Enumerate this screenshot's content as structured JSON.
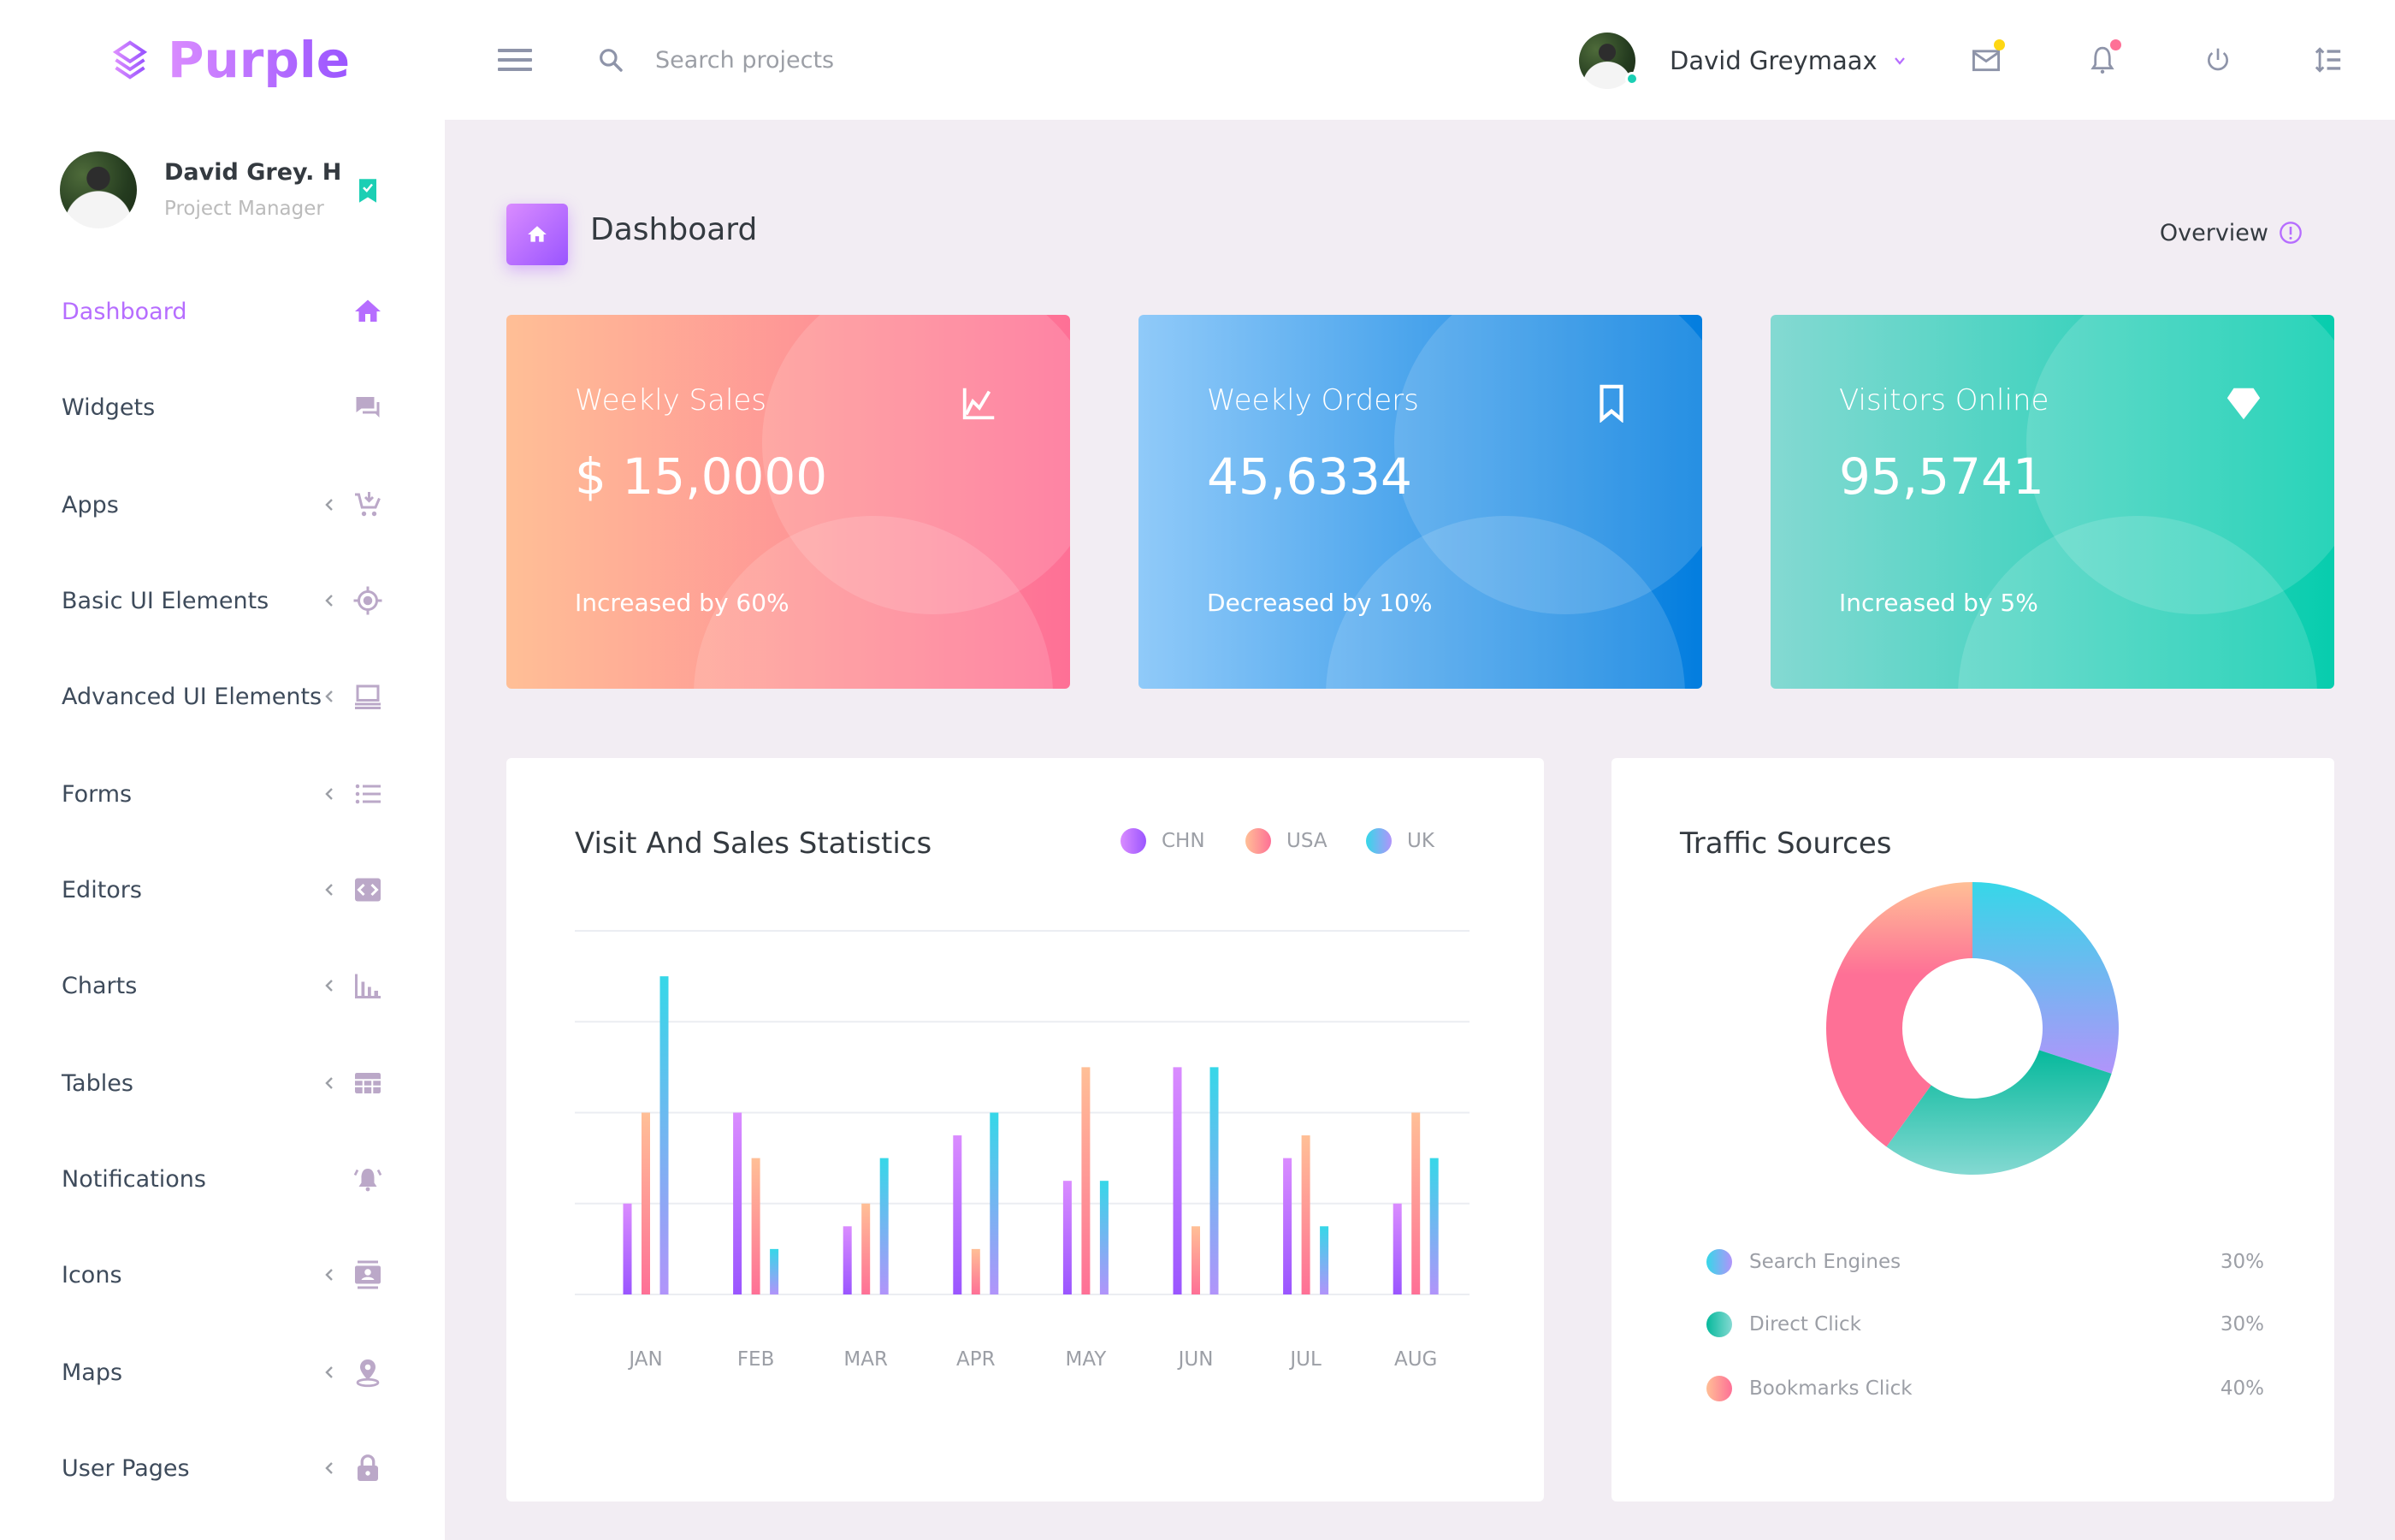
{
  "brand": {
    "name": "Purple",
    "logo_icon": "layers-icon"
  },
  "header": {
    "menu_icon": "hamburger-icon",
    "search": {
      "placeholder": "Search projects",
      "value": ""
    },
    "user": {
      "name": "David Greymaax",
      "status": "online"
    },
    "icons": [
      {
        "name": "mail-icon",
        "badge_color": "#fed713"
      },
      {
        "name": "bell-icon",
        "badge_color": "#fe7096"
      },
      {
        "name": "power-icon"
      },
      {
        "name": "format-line-spacing-icon"
      }
    ]
  },
  "sidebar": {
    "profile": {
      "name": "David Grey. H",
      "role": "Project Manager",
      "badge_icon": "bookmark-check-icon"
    },
    "items": [
      {
        "label": "Dashboard",
        "icon": "home-icon",
        "active": true,
        "expandable": false
      },
      {
        "label": "Widgets",
        "icon": "forum-icon",
        "active": false,
        "expandable": false
      },
      {
        "label": "Apps",
        "icon": "cart-arrow-down-icon",
        "active": false,
        "expandable": true
      },
      {
        "label": "Basic UI Elements",
        "icon": "crosshairs-gps-icon",
        "active": false,
        "expandable": true
      },
      {
        "label": "Advanced UI Elements",
        "icon": "laptop-icon",
        "active": false,
        "expandable": true
      },
      {
        "label": "Forms",
        "icon": "format-list-bulleted-icon",
        "active": false,
        "expandable": true
      },
      {
        "label": "Editors",
        "icon": "code-icon",
        "active": false,
        "expandable": true
      },
      {
        "label": "Charts",
        "icon": "chart-bar-icon",
        "active": false,
        "expandable": true
      },
      {
        "label": "Tables",
        "icon": "table-icon",
        "active": false,
        "expandable": true
      },
      {
        "label": "Notifications",
        "icon": "bell-ring-icon",
        "active": false,
        "expandable": false
      },
      {
        "label": "Icons",
        "icon": "contacts-icon",
        "active": false,
        "expandable": true
      },
      {
        "label": "Maps",
        "icon": "map-marker-icon",
        "active": false,
        "expandable": true
      },
      {
        "label": "User Pages",
        "icon": "lock-icon",
        "active": false,
        "expandable": true
      }
    ]
  },
  "page": {
    "title": "Dashboard",
    "overview_label": "Overview"
  },
  "cards": [
    {
      "title": "Weekly Sales",
      "value": "$ 15,0000",
      "subtitle": "Increased by 60%",
      "icon": "chart-line-icon"
    },
    {
      "title": "Weekly Orders",
      "value": "45,6334",
      "subtitle": "Decreased by 10%",
      "icon": "bookmark-outline-icon"
    },
    {
      "title": "Visitors Online",
      "value": "95,5741",
      "subtitle": "Increased by 5%",
      "icon": "diamond-icon"
    }
  ],
  "colors": {
    "accent": "#b66dff",
    "chn": [
      "#da8cff",
      "#9a55ff"
    ],
    "usa": [
      "#ffbf96",
      "#fe7096"
    ],
    "uk": [
      "#36d7e8",
      "#b194fa"
    ],
    "search_engines": [
      "#36d7e8",
      "#b194fa"
    ],
    "direct_click": [
      "#06b99c",
      "#84d9d2"
    ],
    "bookmarks_click": [
      "#ffbf96",
      "#fe7096"
    ]
  },
  "chart_data": [
    {
      "type": "bar",
      "title": "Visit And Sales Statistics",
      "categories": [
        "JAN",
        "FEB",
        "MAR",
        "APR",
        "MAY",
        "JUN",
        "JUL",
        "AUG"
      ],
      "series": [
        {
          "name": "CHN",
          "values": [
            20,
            40,
            15,
            35,
            25,
            50,
            30,
            20
          ]
        },
        {
          "name": "USA",
          "values": [
            40,
            30,
            20,
            10,
            50,
            15,
            35,
            40
          ]
        },
        {
          "name": "UK",
          "values": [
            70,
            10,
            30,
            40,
            25,
            50,
            15,
            30
          ]
        }
      ],
      "ylim": [
        0,
        80
      ],
      "grid": true,
      "legend": "top-right",
      "xlabel": "",
      "ylabel": ""
    },
    {
      "type": "pie",
      "title": "Traffic Sources",
      "donut": true,
      "slices": [
        {
          "label": "Search Engines",
          "value": 30,
          "display": "30%"
        },
        {
          "label": "Direct Click",
          "value": 30,
          "display": "30%"
        },
        {
          "label": "Bookmarks Click",
          "value": 40,
          "display": "40%"
        }
      ],
      "legend": "bottom"
    }
  ]
}
